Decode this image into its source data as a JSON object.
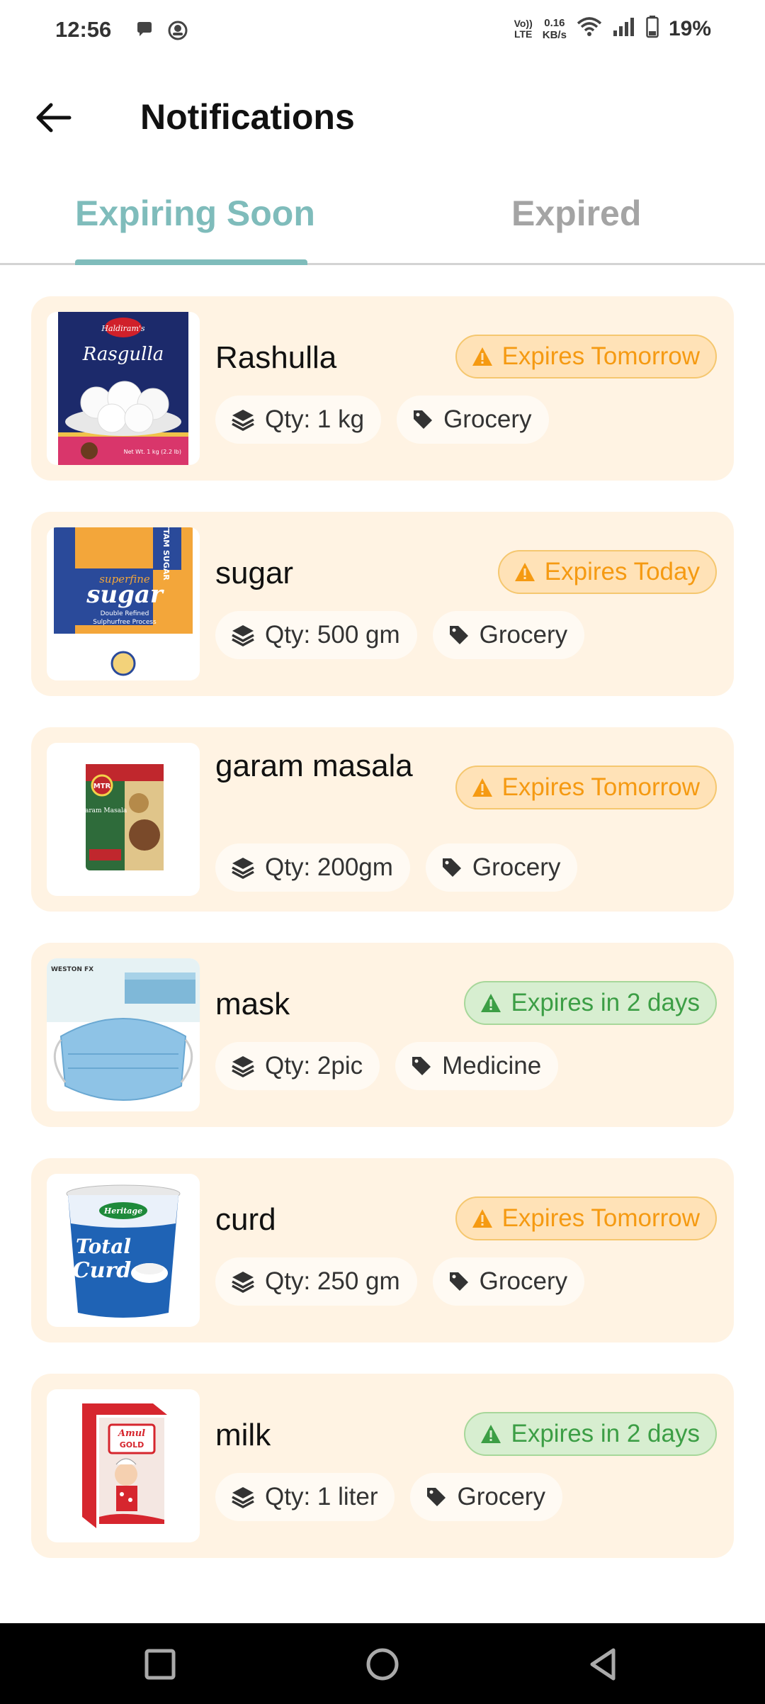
{
  "status_bar": {
    "time": "12:56",
    "volte_line1": "Vo))",
    "volte_line2": "LTE",
    "net_speed_value": "0.16",
    "net_speed_unit": "KB/s",
    "battery_percent": "19%"
  },
  "app_bar": {
    "title": "Notifications",
    "back_icon": "arrow-left-icon"
  },
  "tabs": [
    {
      "label": "Expiring Soon",
      "active": true
    },
    {
      "label": "Expired",
      "active": false
    }
  ],
  "colors": {
    "accent": "#7fbcbb",
    "card_bg": "#fff3e3",
    "badge_orange": "#f59a12",
    "badge_green": "#3c9e45"
  },
  "items": [
    {
      "name": "Rashulla",
      "badge": "Expires Tomorrow",
      "badge_color": "orange",
      "qty": "Qty: 1 kg",
      "category": "Grocery",
      "image": "rasgulla-tin"
    },
    {
      "name": "sugar",
      "badge": "Expires Today",
      "badge_color": "orange",
      "qty": "Qty: 500 gm",
      "category": "Grocery",
      "image": "sugar-pack"
    },
    {
      "name": "garam masala",
      "badge": "Expires Tomorrow",
      "badge_color": "orange",
      "qty": "Qty: 200gm",
      "category": "Grocery",
      "image": "masala-pouch"
    },
    {
      "name": "mask",
      "badge": "Expires in 2 days",
      "badge_color": "green",
      "qty": "Qty: 2pic",
      "category": "Medicine",
      "image": "face-mask"
    },
    {
      "name": "curd",
      "badge": "Expires Tomorrow",
      "badge_color": "orange",
      "qty": "Qty: 250 gm",
      "category": "Grocery",
      "image": "curd-cup"
    },
    {
      "name": "milk",
      "badge": "Expires in 2 days",
      "badge_color": "green",
      "qty": "Qty: 1 liter",
      "category": "Grocery",
      "image": "milk-carton"
    }
  ],
  "product_art": {
    "rasgulla_brand": "Haldiram's",
    "rasgulla_title": "Rasgulla",
    "rasgulla_net": "Net Wt. 1 kg (2.2 lb)",
    "sugar_brand": "UTTAM SUGAR",
    "sugar_sub": "superfine",
    "sugar_title": "sugar",
    "sugar_desc1": "Double Refined",
    "sugar_desc2": "Sulphurfree Process",
    "masala_brand": "MTR",
    "masala_title": "Garam Masala",
    "mask_brand": "WESTON FX",
    "curd_brand": "Heritage",
    "curd_title1": "Total",
    "curd_title2": "Curd",
    "milk_brand1": "Amul",
    "milk_brand2": "GOLD"
  },
  "nav_bar": {
    "recents_icon": "square-icon",
    "home_icon": "circle-icon",
    "back_icon": "triangle-back-icon"
  }
}
